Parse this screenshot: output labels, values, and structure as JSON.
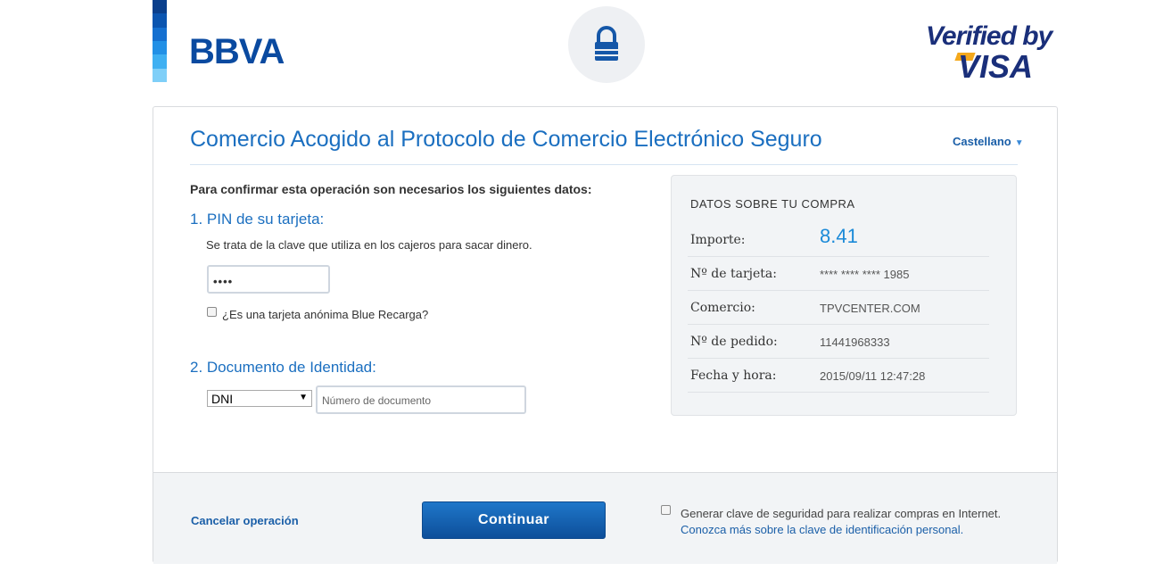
{
  "brand": {
    "bank_name": "BBVA",
    "verified_line1": "Verified by",
    "verified_line2": "VISA"
  },
  "colors": {
    "primary_blue": "#1b6fc0",
    "bbva_blue": "#0a4aa0",
    "visa_navy": "#1a2f7a",
    "visa_gold": "#f4a81c",
    "button_blue": "#1f77c9"
  },
  "icons": [
    "lock-icon",
    "chevron-down-icon",
    "select-arrow-icon"
  ],
  "header": {
    "title": "Comercio Acogido al Protocolo de Comercio Electrónico Seguro",
    "language": "Castellano"
  },
  "form": {
    "intro": "Para confirmar esta operación son necesarios los siguientes datos:",
    "pin_section": "1. PIN de su tarjeta:",
    "pin_help": "Se trata de la clave que utiliza en los cajeros para sacar dinero.",
    "pin_value": "••••",
    "anonymous_label": "¿Es una tarjeta anónima Blue Recarga?",
    "doc_section": "2. Documento de Identidad:",
    "doc_type": "DNI",
    "doc_placeholder": "Número de documento"
  },
  "purchase": {
    "title": "DATOS SOBRE TU COMPRA",
    "rows": [
      {
        "label": "Importe:",
        "value": "8.41"
      },
      {
        "label": "Nº de tarjeta:",
        "value": "**** **** **** 1985"
      },
      {
        "label": "Comercio:",
        "value": "TPVCENTER.COM"
      },
      {
        "label": "Nº de pedido:",
        "value": "11441968333"
      },
      {
        "label": "Fecha y hora:",
        "value": "2015/09/11 12:47:28"
      }
    ]
  },
  "footer": {
    "cancel": "Cancelar operación",
    "continue": "Continuar",
    "generate_key": "Generar clave de seguridad para realizar compras en Internet.",
    "learn_more": "Conozca más sobre la clave de identificación personal."
  }
}
